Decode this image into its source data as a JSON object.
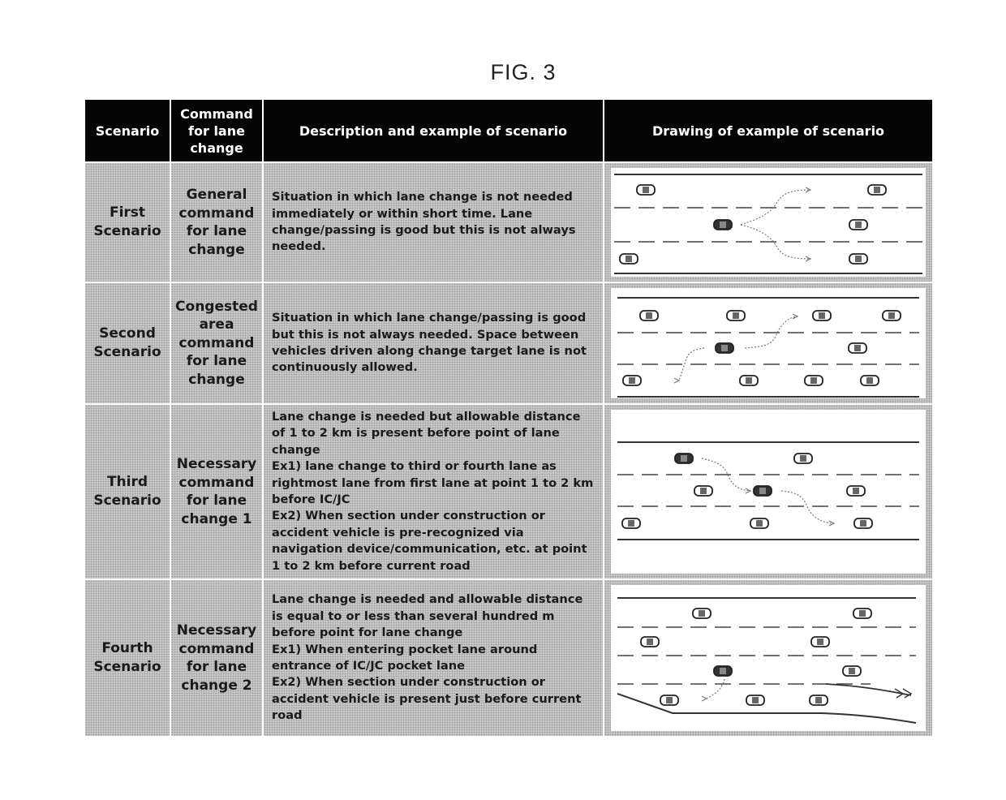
{
  "figure": {
    "title": "FIG. 3"
  },
  "table": {
    "headers": {
      "scenario": "Scenario",
      "command": "Command\nfor lane\nchange",
      "description": "Description and example of scenario",
      "drawing": "Drawing of example of scenario"
    },
    "rows": [
      {
        "scenario": "First\nScenario",
        "command": "General\ncommand\nfor lane\nchange",
        "description": "Situation in which lane change is not needed immediately or within short time.  Lane change/passing is good but this is not always needed.",
        "drawing": {
          "lanes": 3,
          "ego_vehicle": "center lane, middle",
          "surrounding_vehicles": 5,
          "arrows": [
            "to upper lane",
            "to lower lane"
          ]
        }
      },
      {
        "scenario": "Second\nScenario",
        "command": "Congested\narea\ncommand\nfor lane\nchange",
        "description": "Situation in which lane change/passing is good but this is not always needed. Space between vehicles driven along change target lane is not continuously allowed.",
        "drawing": {
          "lanes": 3,
          "ego_vehicle": "center lane",
          "surrounding_vehicles": 9,
          "arrows": [
            "to upper lane",
            "to lower lane"
          ]
        }
      },
      {
        "scenario": "Third\nScenario",
        "command": "Necessary\ncommand\nfor lane\nchange 1",
        "description": "Lane change is needed but allowable distance of 1 to 2 km is present before point of lane change\nEx1) lane change to third or fourth lane as rightmost lane from first lane at point 1 to 2 km before IC/JC\nEx2) When section under construction or accident vehicle is pre-recognized via navigation device/communication, etc. at point 1 to 2 km before current road",
        "drawing": {
          "lanes": 3,
          "ego_vehicle": "top lane, moving stepwise to bottom lane",
          "surrounding_vehicles": 6,
          "arrows": [
            "top to center lane",
            "center to bottom lane"
          ]
        }
      },
      {
        "scenario": "Fourth\nScenario",
        "command": "Necessary\ncommand\nfor lane\nchange 2",
        "description": "Lane change is needed and allowable distance is equal to or less than several hundred m before point for lane change\nEx1) When entering pocket lane around entrance of IC/JC pocket lane\nEx2) When section under construction or accident vehicle is present just before current road",
        "drawing": {
          "lanes": 4,
          "ego_vehicle": "third lane",
          "surrounding_vehicles": 8,
          "arrows": [
            "into pocket lane"
          ],
          "pocket_lane": true
        }
      }
    ]
  }
}
